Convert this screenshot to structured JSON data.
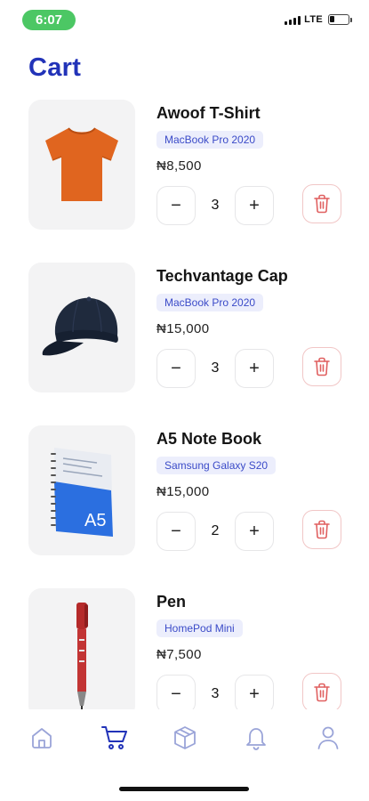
{
  "status_bar": {
    "time": "6:07",
    "network": "LTE",
    "battery_level": 0.25
  },
  "page": {
    "title": "Cart"
  },
  "colors": {
    "accent": "#2233b8",
    "danger": "#e06060",
    "tag_bg": "#eceefc",
    "time_pill": "#4cc764"
  },
  "cart": {
    "items": [
      {
        "name": "Awoof T-Shirt",
        "variant": "MacBook Pro 2020",
        "price": "₦8,500",
        "quantity": "3",
        "image": "tshirt-image"
      },
      {
        "name": "Techvantage Cap",
        "variant": "MacBook Pro 2020",
        "price": "₦15,000",
        "quantity": "3",
        "image": "cap-image"
      },
      {
        "name": "A5 Note Book",
        "variant": "Samsung Galaxy S20",
        "price": "₦15,000",
        "quantity": "2",
        "image": "notebook-image",
        "cover_text": "A5"
      },
      {
        "name": "Pen",
        "variant": "HomePod Mini",
        "price": "₦7,500",
        "quantity": "3",
        "image": "pen-image"
      }
    ],
    "controls": {
      "minus": "−",
      "plus": "+"
    }
  },
  "bottom_nav": {
    "items": [
      {
        "icon": "home-icon",
        "active": false
      },
      {
        "icon": "cart-icon",
        "active": true
      },
      {
        "icon": "box-icon",
        "active": false
      },
      {
        "icon": "bell-icon",
        "active": false
      },
      {
        "icon": "user-icon",
        "active": false
      }
    ]
  }
}
